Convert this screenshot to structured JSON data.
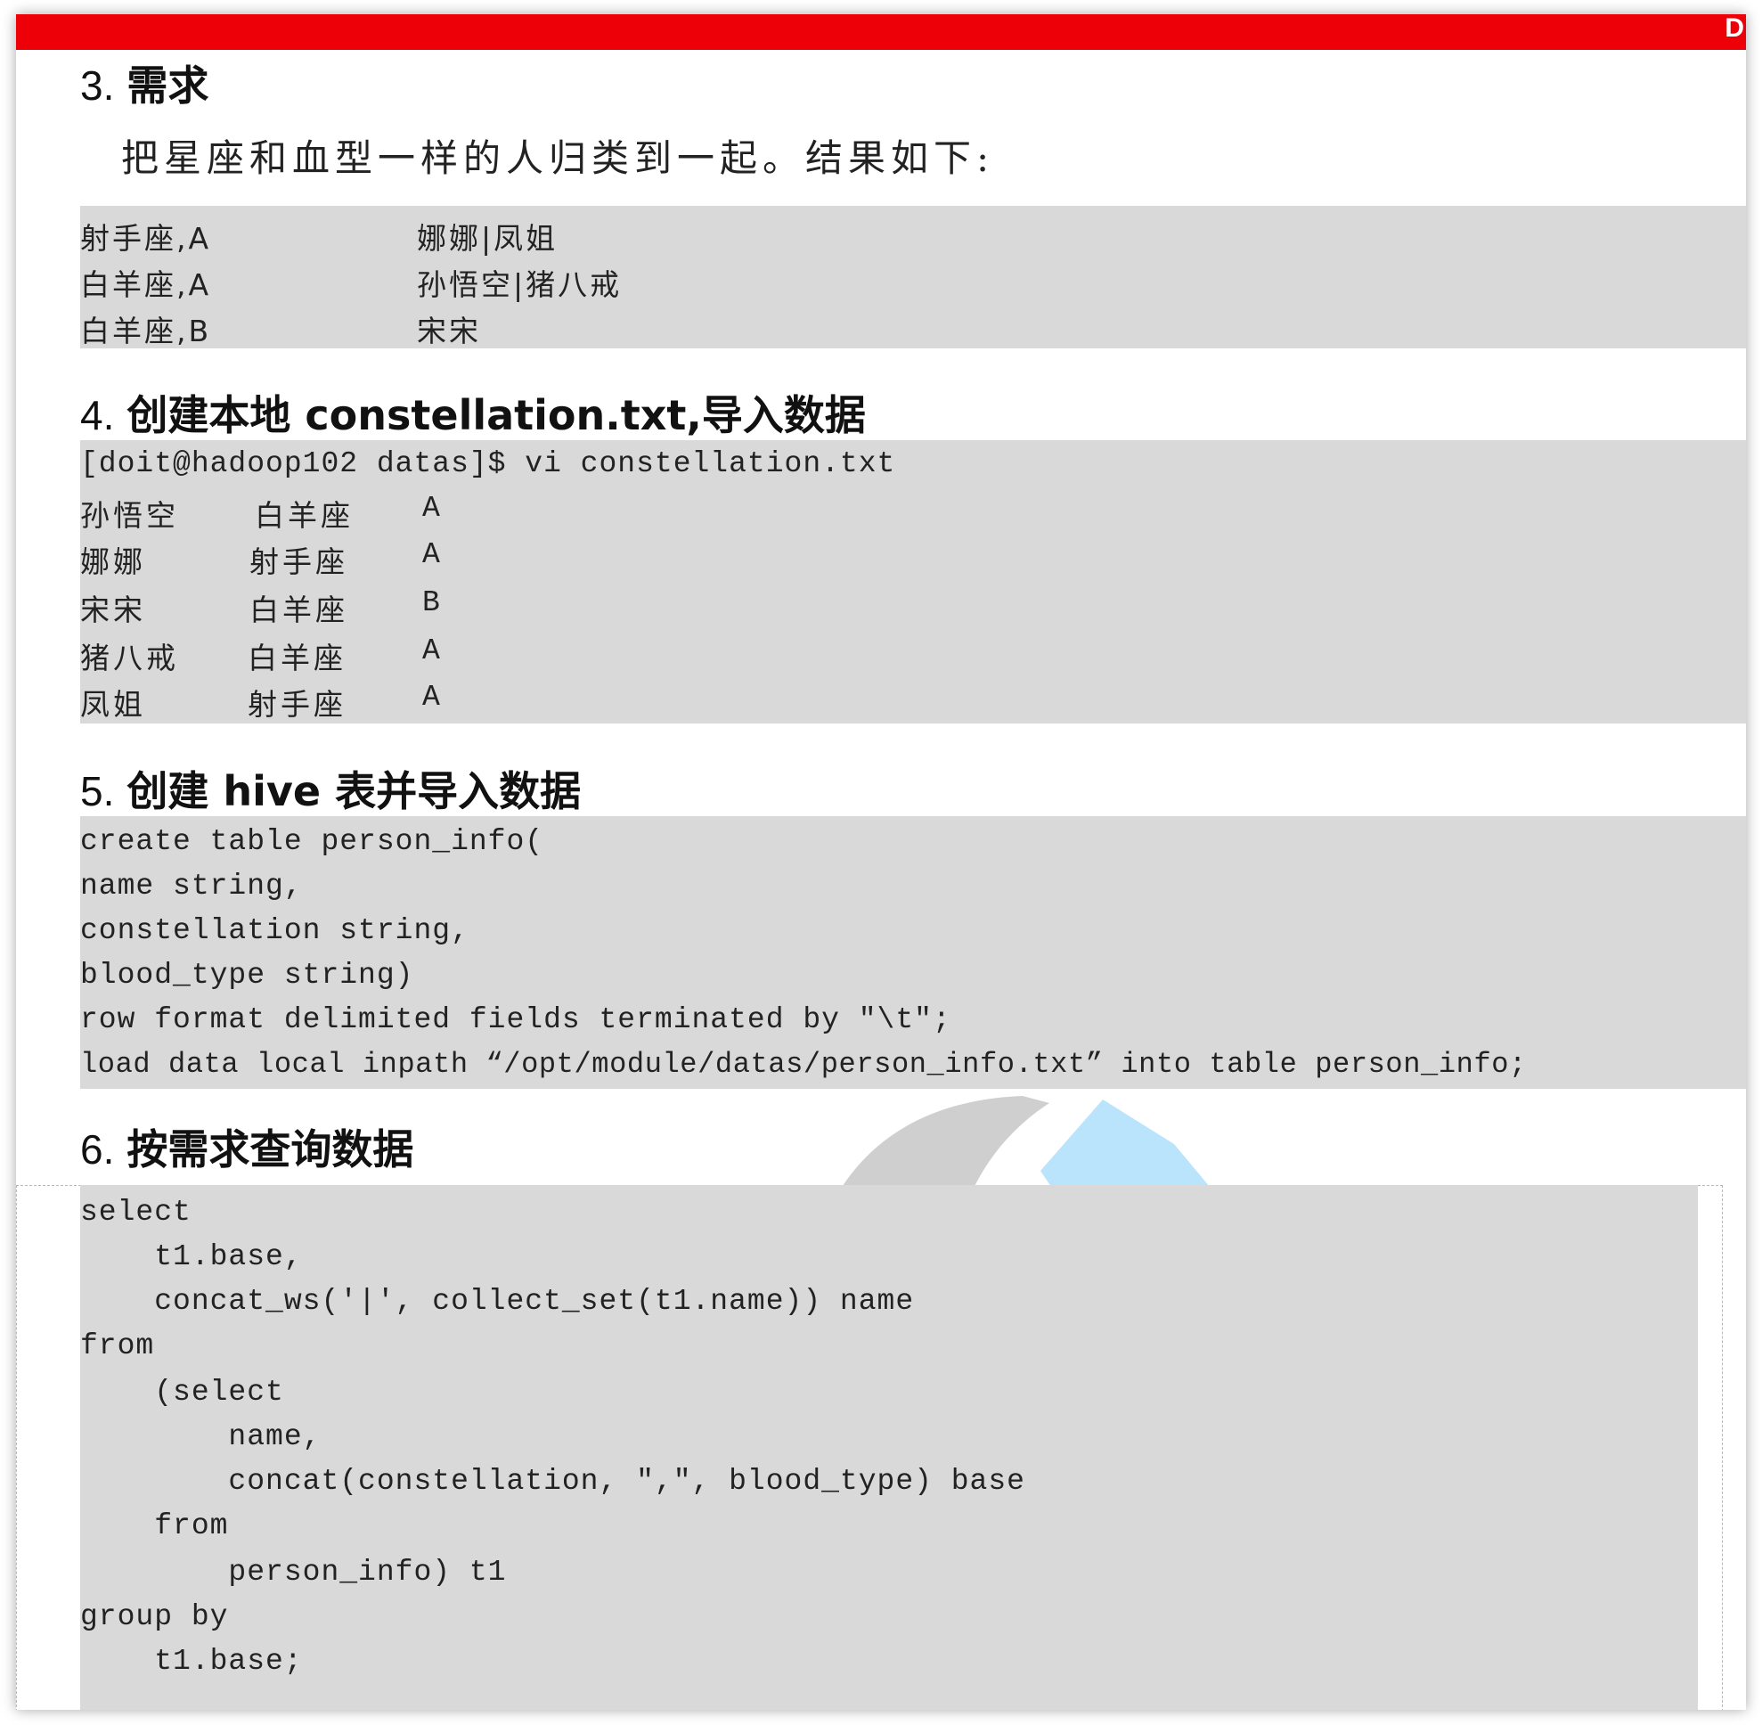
{
  "header": {
    "corner_letter": "D"
  },
  "section3": {
    "heading_num": "3.",
    "heading_text": "需求",
    "description": "把星座和血型一样的人归类到一起。结果如下:",
    "results": [
      {
        "key": "射手座,A",
        "value": "娜娜|凤姐"
      },
      {
        "key": "白羊座,A",
        "value": "孙悟空|猪八戒"
      },
      {
        "key": "白羊座,B",
        "value": "宋宋"
      }
    ]
  },
  "section4": {
    "heading_num": "4.",
    "heading_text": "创建本地 constellation.txt,导入数据",
    "command": "[doit@hadoop102 datas]$ vi constellation.txt",
    "rows": [
      {
        "name": "孙悟空",
        "constellation": "白羊座",
        "blood": "A"
      },
      {
        "name": "娜娜",
        "constellation": "射手座",
        "blood": "A"
      },
      {
        "name": "宋宋",
        "constellation": "白羊座",
        "blood": "B"
      },
      {
        "name": "猪八戒",
        "constellation": "白羊座",
        "blood": "A"
      },
      {
        "name": "凤姐",
        "constellation": "射手座",
        "blood": "A"
      }
    ]
  },
  "section5": {
    "heading_num": "5.",
    "heading_text": "创建 hive 表并导入数据",
    "code": [
      "create table person_info(",
      "name string,",
      "constellation string,",
      "blood_type string)",
      "row format delimited fields terminated by \"\\t\";",
      "load data local inpath “/opt/module/datas/person_info.txt” into table person_info;"
    ]
  },
  "section6": {
    "heading_num": "6.",
    "heading_text": "按需求查询数据",
    "code": [
      "select",
      "    t1.base,",
      "    concat_ws('|', collect_set(t1.name)) name",
      "from",
      "    (select",
      "        name,",
      "        concat(constellation, \",\", blood_type) base",
      "    from",
      "        person_info) t1",
      "group by",
      "    t1.base;"
    ]
  }
}
